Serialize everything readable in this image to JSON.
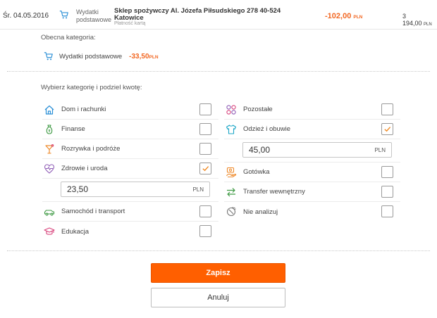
{
  "transaction": {
    "date": "Śr. 04.05.2016",
    "category": "Wydatki podstawowe",
    "merchant": "Sklep spożywczy Al. Józefa Piłsudskiego 278 40-524 Katowice",
    "payment_method": "Płatność kartą",
    "amount": "-102,00",
    "amount_currency": "PLN",
    "balance": "3 194,00",
    "balance_currency": "PLN"
  },
  "current_category": {
    "label": "Obecna kategoria:",
    "name": "Wydatki podstawowe",
    "amount": "-33,50",
    "currency": "PLN"
  },
  "split": {
    "label": "Wybierz kategorię i podziel kwotę:",
    "left_column": [
      {
        "name": "Dom i rachunki",
        "icon": "house-icon",
        "checked": false
      },
      {
        "name": "Finanse",
        "icon": "money-bag-icon",
        "checked": false
      },
      {
        "name": "Rozrywka i podróże",
        "icon": "cocktail-icon",
        "checked": false
      },
      {
        "name": "Zdrowie i uroda",
        "icon": "heart-pulse-icon",
        "checked": true,
        "amount": "23,50",
        "currency": "PLN"
      },
      {
        "name": "Samochód i transport",
        "icon": "car-icon",
        "checked": false
      },
      {
        "name": "Edukacja",
        "icon": "graduation-cap-icon",
        "checked": false
      }
    ],
    "right_column": [
      {
        "name": "Pozostałe",
        "icon": "circles-icon",
        "checked": false
      },
      {
        "name": "Odzież i obuwie",
        "icon": "tshirt-icon",
        "checked": true,
        "amount": "45,00",
        "currency": "PLN"
      },
      {
        "name": "Gotówka",
        "icon": "cash-icon",
        "checked": false
      },
      {
        "name": "Transfer wewnętrzny",
        "icon": "transfer-arrows-icon",
        "checked": false
      },
      {
        "name": "Nie analizuj",
        "icon": "no-analyze-icon",
        "checked": false
      }
    ]
  },
  "buttons": {
    "save": "Zapisz",
    "cancel": "Anuluj"
  },
  "colors": {
    "accent": "#ff5f00",
    "amount_negative": "#f26722",
    "icon_blue": "#2a8fd6",
    "icon_purple": "#8e5bb5",
    "icon_green": "#3f9a44",
    "icon_orange": "#ee8a2b",
    "icon_pink": "#d8437c",
    "icon_cyan": "#19a5c6",
    "check_orange": "#f08a24"
  }
}
